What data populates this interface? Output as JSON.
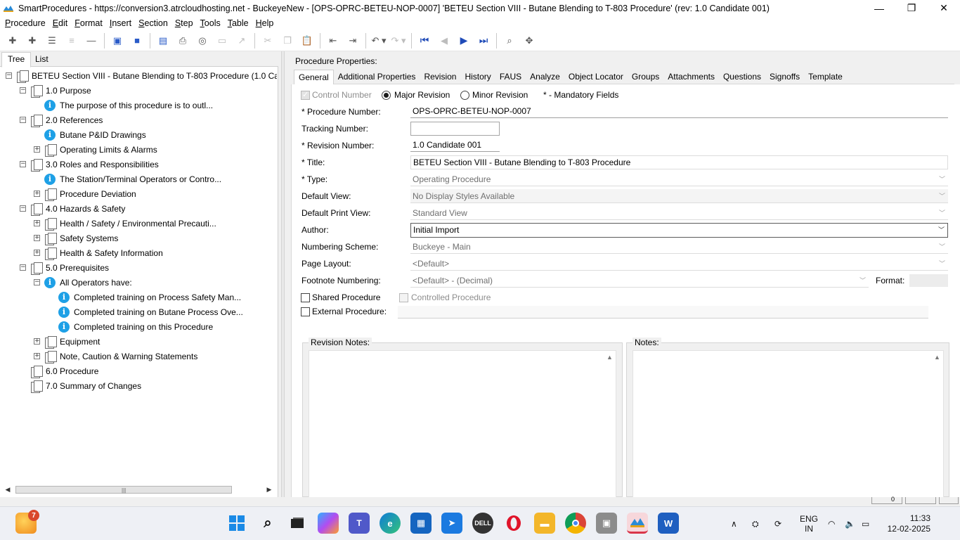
{
  "window": {
    "title": "SmartProcedures - https://conversion3.atrcloudhosting.net - BuckeyeNew - [OPS-OPRC-BETEU-NOP-0007] 'BETEU Section VIII - Butane Blending to T-803 Procedure' (rev: 1.0 Candidate 001)",
    "minimize": "—",
    "maximize": "❐",
    "close": "✕"
  },
  "menu": [
    {
      "first": "P",
      "rest": "rocedure"
    },
    {
      "first": "E",
      "rest": "dit"
    },
    {
      "first": "F",
      "rest": "ormat"
    },
    {
      "first": "I",
      "rest": "nsert"
    },
    {
      "first": "S",
      "rest": "ection"
    },
    {
      "first": "S",
      "rest": "tep"
    },
    {
      "first": "T",
      "rest": "ools"
    },
    {
      "first": "T",
      "rest": "able"
    },
    {
      "first": "H",
      "rest": "elp"
    }
  ],
  "left_tabs": {
    "tree": "Tree",
    "list": "List"
  },
  "tree": [
    {
      "label": "BETEU Section VIII - Butane Blending to T-803 Procedure (1.0 Ca...",
      "level": 0,
      "exp": "−",
      "icon": "doc"
    },
    {
      "label": "1.0 Purpose",
      "level": 1,
      "exp": "−",
      "icon": "doc"
    },
    {
      "label": "The purpose of this procedure is to outl...",
      "level": 2,
      "exp": "",
      "icon": "info"
    },
    {
      "label": "2.0 References",
      "level": 1,
      "exp": "−",
      "icon": "doc"
    },
    {
      "label": "Butane P&ID Drawings",
      "level": 2,
      "exp": "",
      "icon": "info"
    },
    {
      "label": "Operating Limits & Alarms",
      "level": 2,
      "exp": "+",
      "icon": "doc"
    },
    {
      "label": "3.0 Roles and Responsibilities",
      "level": 1,
      "exp": "−",
      "icon": "doc"
    },
    {
      "label": "The Station/Terminal Operators or Contro...",
      "level": 2,
      "exp": "",
      "icon": "info"
    },
    {
      "label": "Procedure Deviation",
      "level": 2,
      "exp": "+",
      "icon": "doc"
    },
    {
      "label": "4.0 Hazards & Safety",
      "level": 1,
      "exp": "−",
      "icon": "doc"
    },
    {
      "label": "Health / Safety / Environmental Precauti...",
      "level": 2,
      "exp": "+",
      "icon": "doc"
    },
    {
      "label": "Safety Systems",
      "level": 2,
      "exp": "+",
      "icon": "doc"
    },
    {
      "label": "Health & Safety Information",
      "level": 2,
      "exp": "+",
      "icon": "doc"
    },
    {
      "label": "5.0 Prerequisites",
      "level": 1,
      "exp": "−",
      "icon": "doc"
    },
    {
      "label": "All Operators have:",
      "level": 2,
      "exp": "−",
      "icon": "info"
    },
    {
      "label": "Completed training on Process Safety Man...",
      "level": 3,
      "exp": "",
      "icon": "info"
    },
    {
      "label": "Completed training on Butane Process Ove...",
      "level": 3,
      "exp": "",
      "icon": "info"
    },
    {
      "label": "Completed training on this Procedure",
      "level": 3,
      "exp": "",
      "icon": "info"
    },
    {
      "label": "Equipment",
      "level": 2,
      "exp": "+",
      "icon": "doc"
    },
    {
      "label": "Note, Caution & Warning Statements",
      "level": 2,
      "exp": "+",
      "icon": "doc"
    },
    {
      "label": "6.0 Procedure",
      "level": 1,
      "exp": "",
      "icon": "doc"
    },
    {
      "label": "7.0 Summary of Changes",
      "level": 1,
      "exp": "",
      "icon": "doc"
    }
  ],
  "props": {
    "header": "Procedure Properties:",
    "tabs": [
      "General",
      "Additional Properties",
      "Revision",
      "History",
      "FAUS",
      "Analyze",
      "Object Locator",
      "Groups",
      "Attachments",
      "Questions",
      "Signoffs",
      "Template"
    ],
    "control_number": "Control Number",
    "major_revision": "Major Revision",
    "minor_revision": "Minor Revision",
    "mandatory_note": "* - Mandatory Fields",
    "procedure_number_label": "* Procedure Number:",
    "procedure_number": "OPS-OPRC-BETEU-NOP-0007",
    "tracking_number_label": "Tracking Number:",
    "tracking_number": "",
    "revision_number_label": "* Revision Number:",
    "revision_number": "1.0 Candidate 001",
    "title_label": "* Title:",
    "title": "BETEU Section VIII - Butane Blending to T-803 Procedure",
    "type_label": "* Type:",
    "type": "Operating Procedure",
    "default_view_label": "Default View:",
    "default_view": "No Display Styles Available",
    "default_print_view_label": "Default Print View:",
    "default_print_view": "Standard View",
    "author_label": "Author:",
    "author": "Initial Import",
    "numbering_scheme_label": "Numbering Scheme:",
    "numbering_scheme": "Buckeye - Main",
    "page_layout_label": "Page Layout:",
    "page_layout": "<Default>",
    "footnote_numbering_label": "Footnote Numbering:",
    "footnote_numbering": "<Default> - (Decimal)",
    "format_label": "Format:",
    "shared_procedure": "Shared Procedure",
    "controlled_procedure": "Controlled Procedure",
    "external_procedure": "External Procedure:",
    "revision_notes": "Revision Notes:",
    "notes": "Notes:"
  },
  "statusbar": {
    "slot2": "0"
  },
  "taskbar": {
    "notification_count": "7",
    "lang_line1": "ENG",
    "lang_line2": "IN",
    "time": "11:33",
    "date": "12-02-2025"
  }
}
